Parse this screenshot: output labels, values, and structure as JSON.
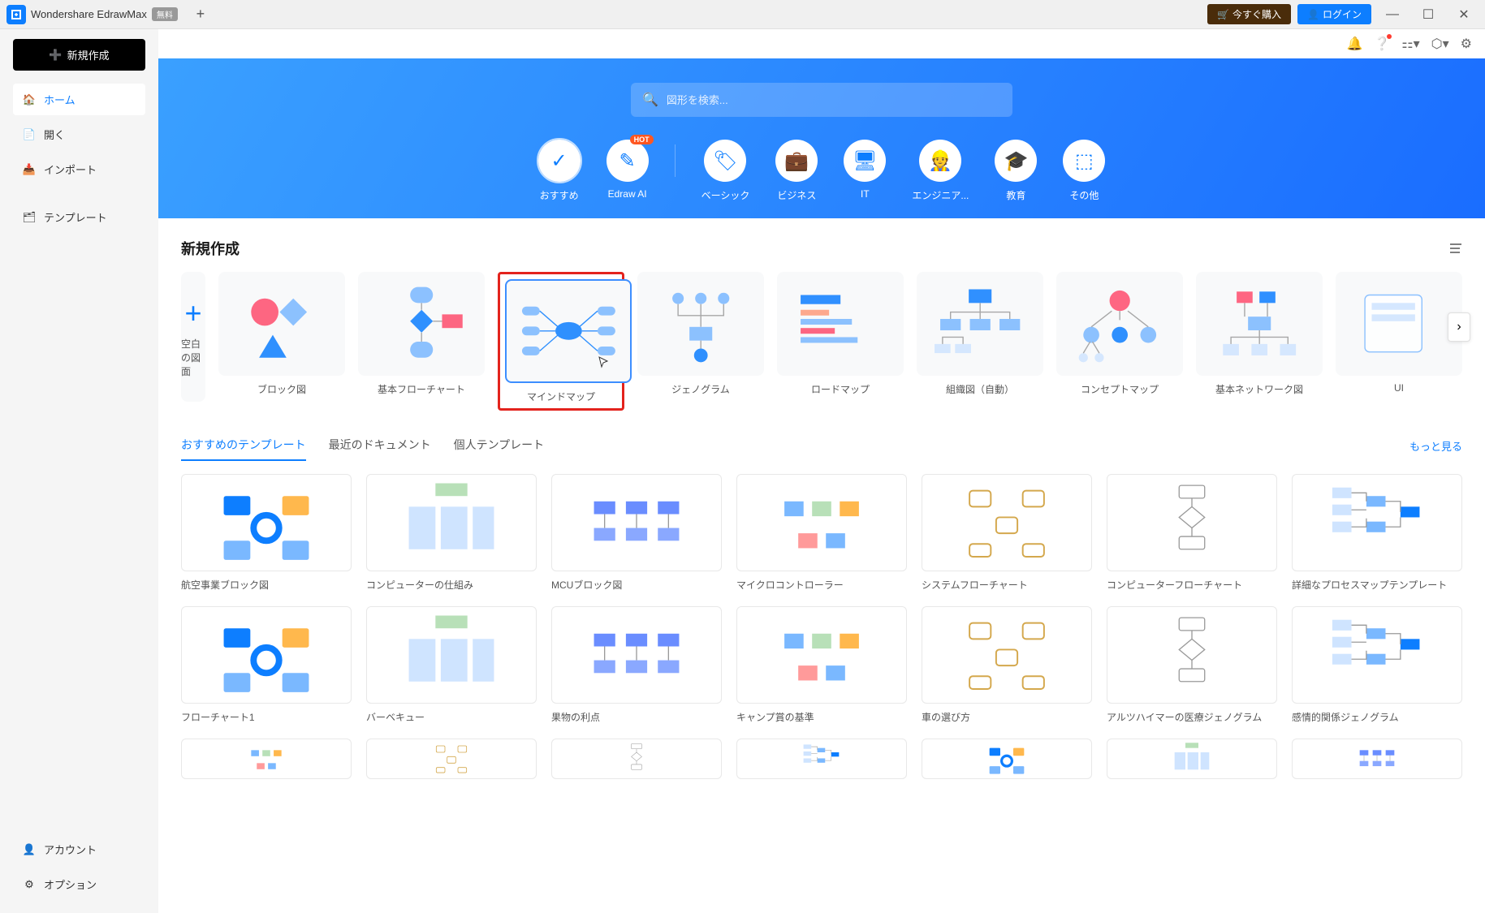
{
  "app": {
    "name": "Wondershare EdrawMax",
    "free_badge": "無料",
    "buy": "今すぐ購入",
    "login": "ログイン"
  },
  "sidebar": {
    "new_button": "新規作成",
    "items": [
      {
        "label": "ホーム",
        "icon": "home",
        "active": true
      },
      {
        "label": "開く",
        "icon": "file"
      },
      {
        "label": "インポート",
        "icon": "import"
      },
      {
        "label": "テンプレート",
        "icon": "template"
      }
    ],
    "bottom": [
      {
        "label": "アカウント",
        "icon": "user"
      },
      {
        "label": "オプション",
        "icon": "gear"
      }
    ]
  },
  "hero": {
    "search_placeholder": "図形を検索...",
    "categories": [
      {
        "label": "おすすめ",
        "active": true
      },
      {
        "label": "Edraw AI",
        "hot": true
      },
      {
        "label": "ベーシック"
      },
      {
        "label": "ビジネス"
      },
      {
        "label": "IT"
      },
      {
        "label": "エンジニア..."
      },
      {
        "label": "教育"
      },
      {
        "label": "その他"
      }
    ]
  },
  "new_section": {
    "title": "新規作成",
    "blank": "空白の図面",
    "cards": [
      {
        "label": "ブロック図"
      },
      {
        "label": "基本フローチャート"
      },
      {
        "label": "マインドマップ",
        "highlighted": true
      },
      {
        "label": "ジェノグラム"
      },
      {
        "label": "ロードマップ"
      },
      {
        "label": "組織図（自動）"
      },
      {
        "label": "コンセプトマップ"
      },
      {
        "label": "基本ネットワーク図"
      },
      {
        "label": "UI"
      }
    ]
  },
  "tabs": {
    "items": [
      "おすすめのテンプレート",
      "最近のドキュメント",
      "個人テンプレート"
    ],
    "active": 0,
    "see_more": "もっと見る"
  },
  "templates": [
    "航空事業ブロック図",
    "コンピューターの仕組み",
    "MCUブロック図",
    "マイクロコントローラー",
    "システムフローチャート",
    "コンピューターフローチャート",
    "詳細なプロセスマップテンプレート",
    "フローチャート1",
    "バーベキュー",
    "果物の利点",
    "キャンプ賞の基準",
    "車の選び方",
    "アルツハイマーの医療ジェノグラム",
    "感情的関係ジェノグラム"
  ]
}
